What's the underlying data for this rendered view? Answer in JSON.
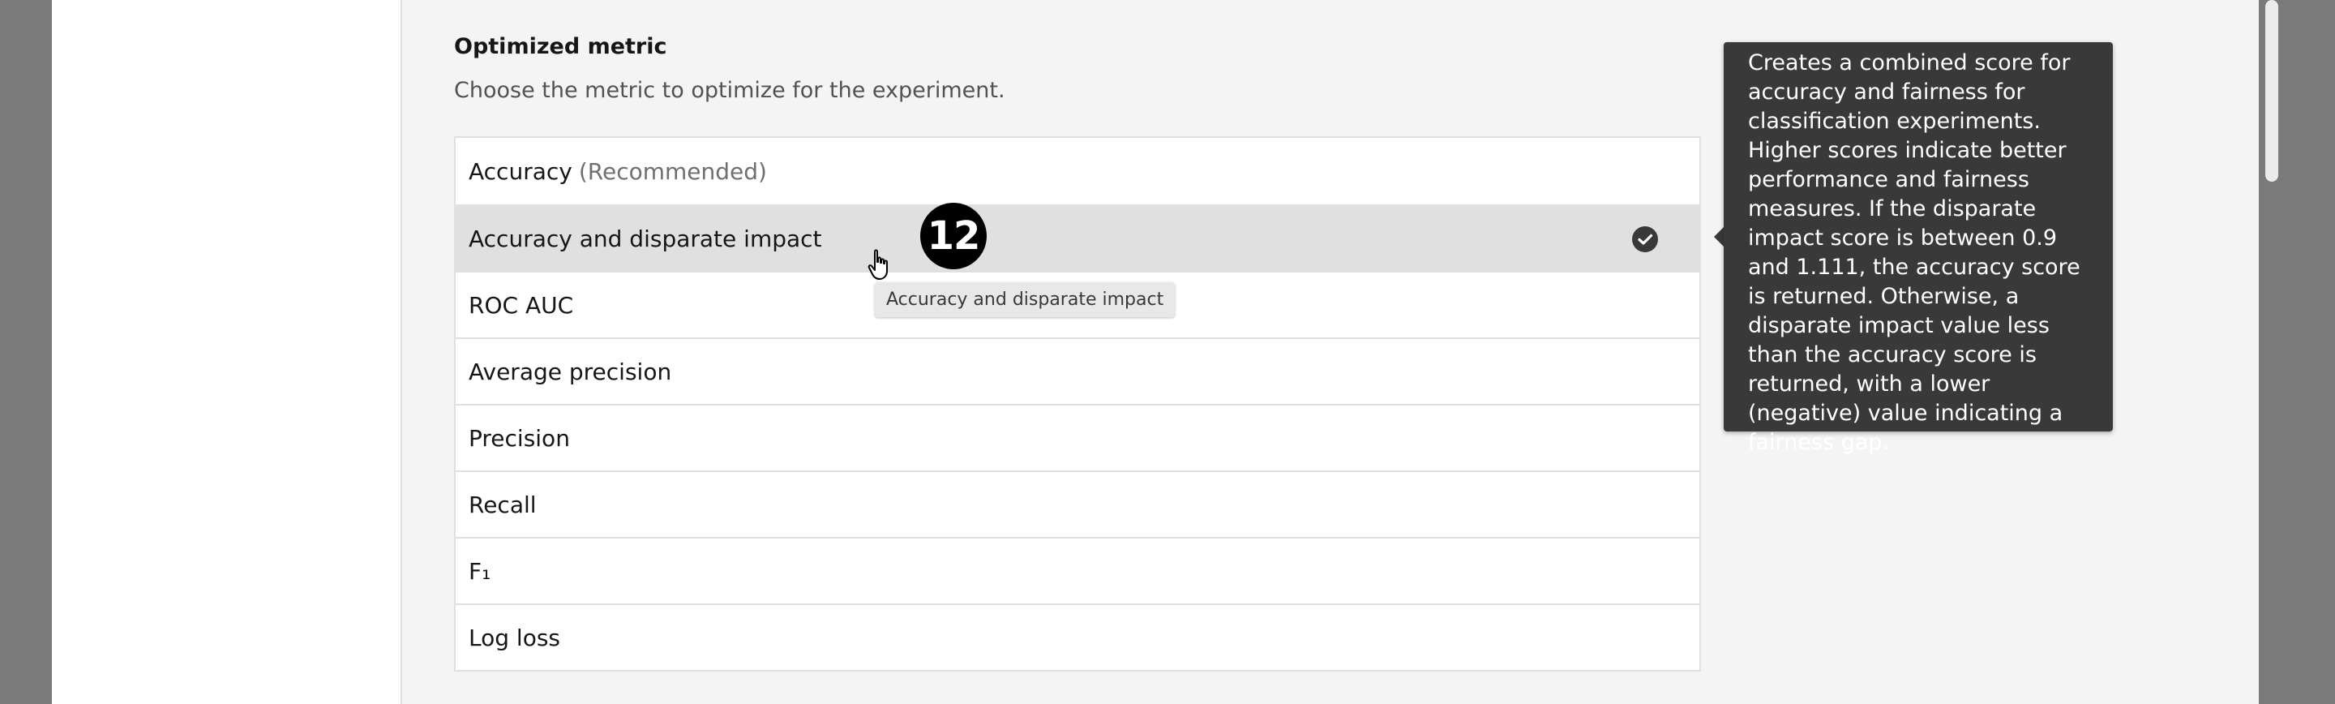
{
  "section": {
    "title": "Optimized metric",
    "description": "Choose the metric to optimize for the experiment."
  },
  "metrics": [
    {
      "label": "Accuracy",
      "suffix": "(Recommended)",
      "selected": false
    },
    {
      "label": "Accuracy and disparate impact",
      "suffix": "",
      "selected": true
    },
    {
      "label": "ROC AUC",
      "suffix": "",
      "selected": false
    },
    {
      "label": "Average precision",
      "suffix": "",
      "selected": false
    },
    {
      "label": "Precision",
      "suffix": "",
      "selected": false
    },
    {
      "label": "Recall",
      "suffix": "",
      "selected": false
    },
    {
      "label": "F₁",
      "suffix": "",
      "selected": false
    },
    {
      "label": "Log loss",
      "suffix": "",
      "selected": false
    }
  ],
  "hover_tooltip": "Accuracy and disparate impact",
  "step_badge": "12",
  "info_tooltip": "Creates a combined score for accuracy and fairness for classification experiments. Higher scores indicate better performance and fairness measures. If the disparate impact score is between 0.9 and 1.111, the accuracy score is returned. Otherwise, a disparate impact value less than the accuracy score is returned, with a lower (negative) value indicating a fairness gap.",
  "icons": {
    "selected": "checkmark-filled-icon",
    "cursor": "hand-pointer-icon"
  },
  "colors": {
    "selected_row": "#e0e0e0",
    "tooltip_bg": "#393939",
    "overlay": "#7a7a7a"
  }
}
